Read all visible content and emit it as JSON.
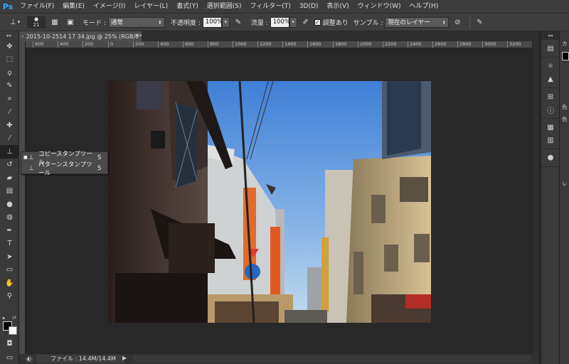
{
  "app": {
    "logo": "Ps",
    "menu": [
      "ファイル(F)",
      "編集(E)",
      "イメージ(I)",
      "レイヤー(L)",
      "書式(Y)",
      "選択範囲(S)",
      "フィルター(T)",
      "3D(D)",
      "表示(V)",
      "ウィンドウ(W)",
      "ヘルプ(H)"
    ]
  },
  "options_bar": {
    "tool_icon": "clone-stamp-icon",
    "brush_size": "21",
    "mode_label": "モード :",
    "mode_value": "通常",
    "opacity_label": "不透明度 :",
    "opacity_value": "100%",
    "flow_label": "流量 :",
    "flow_value": "100%",
    "aligned_checked": true,
    "aligned_label": "調整あり",
    "sample_label": "サンプル :",
    "sample_value": "現在のレイヤー"
  },
  "document": {
    "tab_title": "2015-10-2514 17 34.jpg @ 25% (RGB/8*)",
    "ruler_ticks": [
      "600",
      "400",
      "200",
      "0",
      "200",
      "400",
      "600",
      "800",
      "1000",
      "1200",
      "1400",
      "1600",
      "1800",
      "2000",
      "2200",
      "2400",
      "2600",
      "2800",
      "3000",
      "3200"
    ],
    "status_info": "ファイル : 14.4M/14.4M"
  },
  "tool_flyout": {
    "items": [
      {
        "selected": true,
        "icon": "clone-stamp-icon",
        "label": "コピースタンプツール",
        "shortcut": "S"
      },
      {
        "selected": false,
        "icon": "pattern-stamp-icon",
        "label": "パターンスタンプツール",
        "shortcut": "S"
      }
    ]
  },
  "colors": {
    "foreground": "#000000",
    "background": "#ffffff",
    "accent": "#31a8ff"
  },
  "right_panel": {
    "labels": [
      "カ",
      "色",
      "色",
      "レ"
    ]
  }
}
